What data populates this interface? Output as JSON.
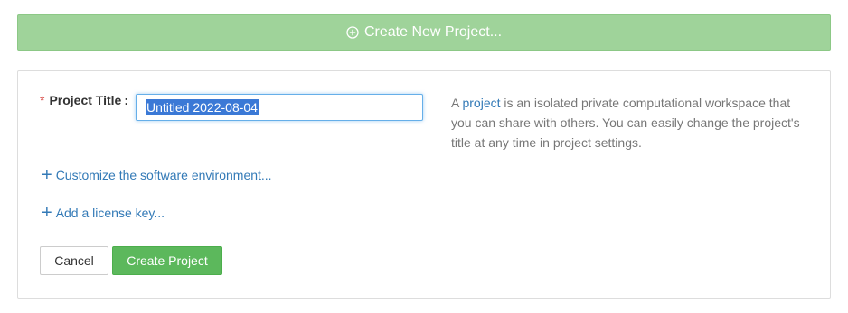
{
  "banner": {
    "label": "Create New Project...",
    "icon": "plus-circle-icon"
  },
  "form": {
    "title_label": "Project Title",
    "required_mark": "*",
    "colon": ":",
    "title_value": "Untitled 2022-08-04",
    "help": {
      "prefix": "A ",
      "link": "project",
      "suffix": " is an isolated private computational workspace that you can share with others. You can easily change the project's title at any time in project settings."
    },
    "customize_link": "Customize the software environment...",
    "license_link": "Add a license key...",
    "plus_glyph": "+",
    "cancel_label": "Cancel",
    "create_label": "Create Project"
  },
  "colors": {
    "banner": "#9fd39a",
    "primary_link": "#337ab7",
    "create_button": "#5cb85c",
    "required": "#d9534f"
  }
}
